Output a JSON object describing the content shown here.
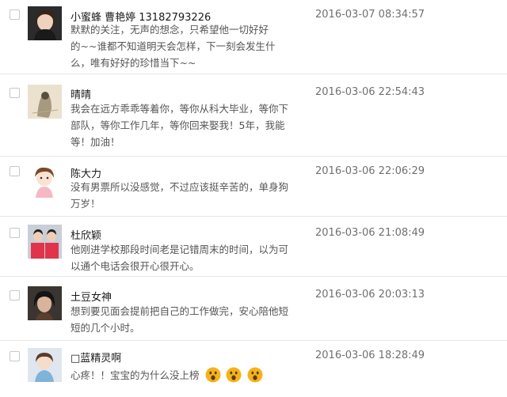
{
  "comments": [
    {
      "name": "小蜜蜂 曹艳婷 13182793226",
      "time": "2016-03-07 08:34:57",
      "lines": [
        "默默的关注，无声的想念，只希望他一切好好",
        "的~~谁都不知道明天会怎样，下一刻会发生什",
        "么，唯有好好的珍惜当下~~"
      ]
    },
    {
      "name": "晴晴",
      "time": "2016-03-06 22:54:43",
      "lines": [
        "我会在远方乖乖等着你，等你从科大毕业，等你下",
        "部队，等你工作几年，等你回来娶我！5年，我能",
        "等！加油！"
      ]
    },
    {
      "name": "陈大力",
      "time": "2016-03-06 22:06:29",
      "lines": [
        "没有男票所以没感觉，不过应该挺辛苦的，单身狗",
        "万岁！"
      ]
    },
    {
      "name": "杜欣颖",
      "time": "2016-03-06 21:08:49",
      "lines": [
        "他刚进学校那段时间老是记错周末的时间，以为可",
        "以通个电话会很开心很开心。"
      ]
    },
    {
      "name": "土豆女神",
      "time": "2016-03-06 20:03:13",
      "lines": [
        "想到要见面会提前把自己的工作做完，安心陪他短",
        "短的几个小时。"
      ]
    },
    {
      "name": "□蓝精灵啊",
      "time": "2016-03-06 18:28:49",
      "lines": [
        "心疼！！宝宝的为什么没上榜"
      ]
    }
  ],
  "icons": {
    "checkbox": "checkbox-icon",
    "avatar": "avatar-image",
    "emoji": "surprised-face-icon"
  },
  "colors": {
    "name": "#1a1a1a",
    "message": "#555555",
    "timestamp": "#707070",
    "divider": "#e6e6e6",
    "emoji": "#f5b31b"
  }
}
